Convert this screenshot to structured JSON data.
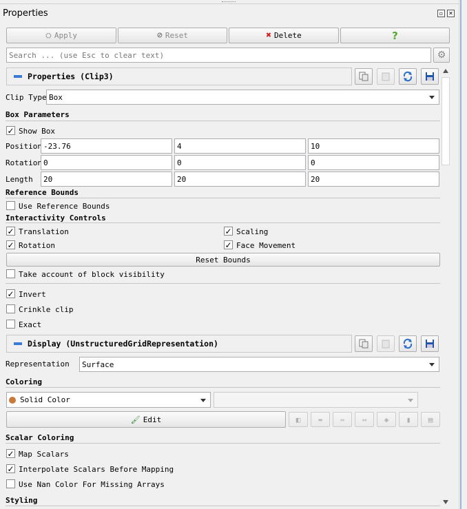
{
  "panel": {
    "title": "Properties"
  },
  "toolbar": {
    "apply": "Apply",
    "reset": "Reset",
    "delete": "Delete",
    "help": "?"
  },
  "search": {
    "placeholder": "Search ... (use Esc to clear text)"
  },
  "properties_section": {
    "title": "Properties (Clip3)"
  },
  "clip_type": {
    "label": "Clip Type",
    "value": "Box"
  },
  "box_parameters": {
    "header": "Box Parameters",
    "show_box": "Show Box",
    "position": {
      "label": "Position",
      "values": [
        "-23.76",
        "4",
        "10"
      ]
    },
    "rotation": {
      "label": "Rotation",
      "values": [
        "0",
        "0",
        "0"
      ]
    },
    "length": {
      "label": "Length",
      "values": [
        "20",
        "20",
        "20"
      ]
    }
  },
  "reference_bounds": {
    "header": "Reference Bounds",
    "use_reference_bounds": "Use Reference Bounds"
  },
  "interactivity": {
    "header": "Interactivity Controls",
    "translation": "Translation",
    "scaling": "Scaling",
    "rotation": "Rotation",
    "face_movement": "Face Movement",
    "reset_bounds": "Reset Bounds"
  },
  "block_visibility": "Take account of block visibility",
  "invert": "Invert",
  "crinkle_clip": "Crinkle clip",
  "exact": "Exact",
  "display_section": {
    "title": "Display (UnstructuredGridRepresentation)"
  },
  "representation": {
    "label": "Representation",
    "value": "Surface"
  },
  "coloring": {
    "header": "Coloring",
    "value": "Solid Color",
    "edit": "Edit",
    "swatch_color": "#c67a3c"
  },
  "scalar_coloring": {
    "header": "Scalar Coloring",
    "map_scalars": "Map Scalars",
    "interpolate": "Interpolate Scalars Before Mapping",
    "nan_color": "Use Nan Color For Missing Arrays"
  },
  "styling": {
    "header": "Styling"
  }
}
